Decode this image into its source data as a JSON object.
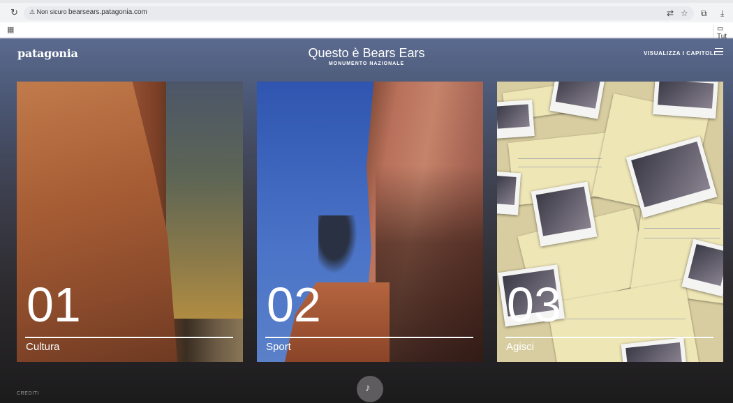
{
  "browser": {
    "security_label": "⚠ Non sicuro",
    "url": "bearsears.patagonia.com",
    "bookmark_folder": "Tut"
  },
  "header": {
    "logo": "patagonia",
    "title": "Questo è Bears Ears",
    "subtitle": "MONUMENTO NAZIONALE",
    "chapters_link": "VISUALIZZA I CAPITOLI"
  },
  "chapters": [
    {
      "number": "01",
      "label": "Cultura"
    },
    {
      "number": "02",
      "label": "Sport"
    },
    {
      "number": "03",
      "label": "Agisci"
    }
  ],
  "footer": {
    "credits": "CREDITI"
  },
  "icons": [
    "reload-icon",
    "warning-icon",
    "translate-icon",
    "star-icon",
    "extensions-icon",
    "download-icon",
    "apps-icon",
    "folder-icon",
    "menu-icon",
    "audio-toggle-icon"
  ],
  "colors": {
    "page_top": "#5a6a8f",
    "page_bottom": "#1c1b1c",
    "text": "#ffffff"
  }
}
